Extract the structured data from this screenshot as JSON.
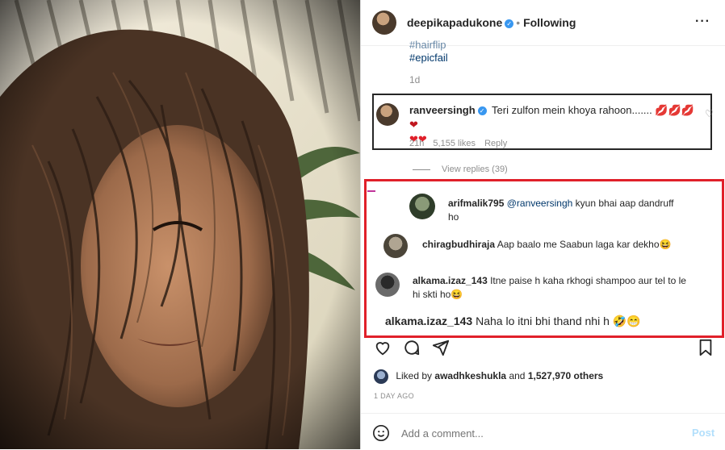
{
  "post": {
    "header": {
      "username": "deepikapadukone",
      "dot": "•",
      "follow_status": "Following",
      "more": "···"
    },
    "caption_tags": [
      "#hairflip",
      "#epicfail"
    ],
    "caption_age": "1d",
    "top_comment": {
      "username": "ranveersingh",
      "text": "Teri zulfon mein khoya rahoon.......",
      "emoji_line1": "💋💋💋❤",
      "emoji_line2": "❤❤",
      "time": "21h",
      "likes": "5,155 likes",
      "reply_label": "Reply"
    },
    "view_replies": "View replies (39)",
    "replies": [
      {
        "username": "arifmalik795",
        "mention": "@ranveersingh",
        "text": "kyun bhai aap dandruff",
        "text2": "ho"
      },
      {
        "username": "chiragbudhiraja",
        "text": "Aap baalo me Saabun laga kar dekho😆"
      },
      {
        "username": "alkama.izaz_143",
        "text": "Itne paise h kaha rkhogi shampoo aur tel to le",
        "text2": "hi skti ho😆"
      },
      {
        "username": "alkama.izaz_143",
        "text": "Naha lo itni bhi thand nhi h",
        "emoji": "🤣😁"
      }
    ],
    "liked_by_prefix": "Liked by",
    "liked_by_user": "awadhkeshukla",
    "liked_by_and": "and",
    "liked_by_count": "1,527,970 others",
    "date": "1 DAY AGO",
    "comment_placeholder": "Add a comment...",
    "post_button": "Post",
    "icons": {
      "heart": "heart-icon",
      "comment": "comment-icon",
      "share": "share-icon",
      "save": "bookmark-icon",
      "emoji": "emoji-icon",
      "verified": "verified-badge-icon",
      "more": "more-options-icon"
    },
    "colors": {
      "highlight_red": "#e0202a",
      "link_blue": "#00376b",
      "post_button": "#b2dffc",
      "muted": "#8e8e8e"
    }
  }
}
